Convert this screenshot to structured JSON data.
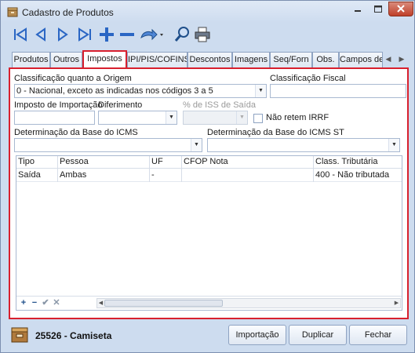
{
  "window": {
    "title": "Cadastro de Produtos"
  },
  "toolbar": {
    "buttons": [
      {
        "name": "first-record-icon"
      },
      {
        "name": "previous-record-icon"
      },
      {
        "name": "next-record-icon"
      },
      {
        "name": "last-record-icon"
      },
      {
        "name": "add-icon"
      },
      {
        "name": "remove-icon"
      },
      {
        "name": "undo-icon"
      },
      {
        "name": "search-icon"
      },
      {
        "name": "print-icon"
      }
    ]
  },
  "tabs": [
    {
      "label": "Produtos"
    },
    {
      "label": "Outros"
    },
    {
      "label": "Impostos",
      "active": true
    },
    {
      "label": "IPI/PIS/COFINS"
    },
    {
      "label": "Descontos"
    },
    {
      "label": "Imagens"
    },
    {
      "label": "Seq/Forn"
    },
    {
      "label": "Obs."
    },
    {
      "label": "Campos de"
    }
  ],
  "form": {
    "origem_label": "Classificação quanto a Origem",
    "origem_value": "0 - Nacional, exceto as indicadas nos códigos 3 a 5",
    "classificacao_fiscal_label": "Classificação Fiscal",
    "classificacao_fiscal_value": "",
    "imposto_importacao_label": "Imposto de Importação",
    "imposto_importacao_value": "",
    "diferimento_label": "Diferimento",
    "diferimento_value": "",
    "iss_saida_label": "% de ISS de Saída",
    "iss_saida_value": "",
    "nao_retem_irrf_label": "Não retem IRRF",
    "nao_retem_irrf_checked": false,
    "base_icms_label": "Determinação da Base do ICMS",
    "base_icms_value": "",
    "base_icms_st_label": "Determinação da Base do ICMS ST",
    "base_icms_st_value": ""
  },
  "grid": {
    "columns": [
      "Tipo",
      "Pessoa",
      "UF",
      "CFOP Nota",
      "Class. Tributária"
    ],
    "rows": [
      [
        "Saída",
        "Ambas",
        "-",
        "",
        "400 - Não tributada"
      ]
    ],
    "nav": {
      "add": "+",
      "remove": "−",
      "confirm": "✔",
      "cancel": "✕"
    }
  },
  "footer": {
    "product_code": "25526",
    "product_name": "Camiseta",
    "product_display": "25526 - Camiseta",
    "buttons": {
      "importacao": "Importação",
      "duplicar": "Duplicar",
      "fechar": "Fechar"
    }
  },
  "colors": {
    "highlight": "#d8202e",
    "window_bg": "#cddcef",
    "accent_blue": "#2a66c4"
  }
}
